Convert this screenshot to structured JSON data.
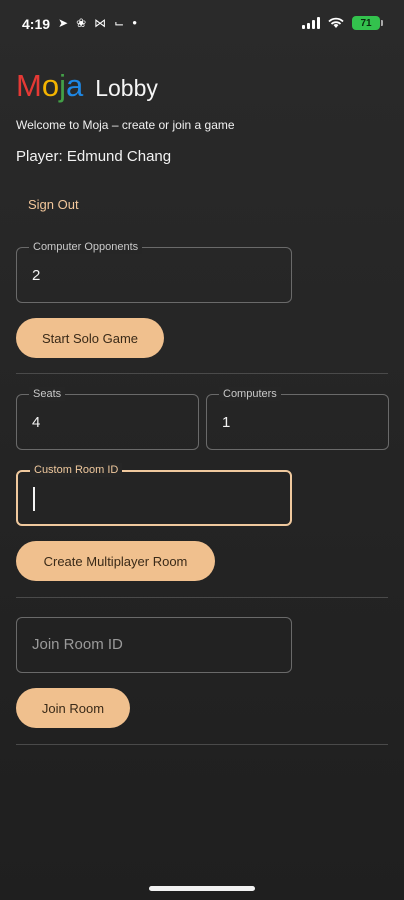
{
  "status_bar": {
    "time": "4:19",
    "left_icons": [
      "telegram-icon",
      "flower-icon",
      "bowtie-icon",
      "drone-icon",
      "dot-icon"
    ],
    "battery": "71",
    "battery_color": "#33c24d"
  },
  "header": {
    "logo_letters": [
      "M",
      "o",
      "j",
      "a"
    ],
    "logo_colors": [
      "#e53935",
      "#f4b400",
      "#43a047",
      "#1e88e5"
    ],
    "title": "Lobby",
    "subtitle": "Welcome to Moja – create or join a game",
    "player": "Player: Edmund Chang",
    "sign_out": "Sign Out"
  },
  "solo": {
    "opponents_label": "Computer Opponents",
    "opponents_value": "2",
    "start_button": "Start Solo Game"
  },
  "multiplayer": {
    "seats_label": "Seats",
    "seats_value": "4",
    "computers_label": "Computers",
    "computers_value": "1",
    "room_id_label": "Custom Room ID",
    "room_id_value": "",
    "create_button": "Create Multiplayer Room"
  },
  "join": {
    "room_id_placeholder": "Join Room ID",
    "join_button": "Join Room"
  },
  "theme": {
    "accent": "#f0c08e",
    "background": "#262626"
  }
}
